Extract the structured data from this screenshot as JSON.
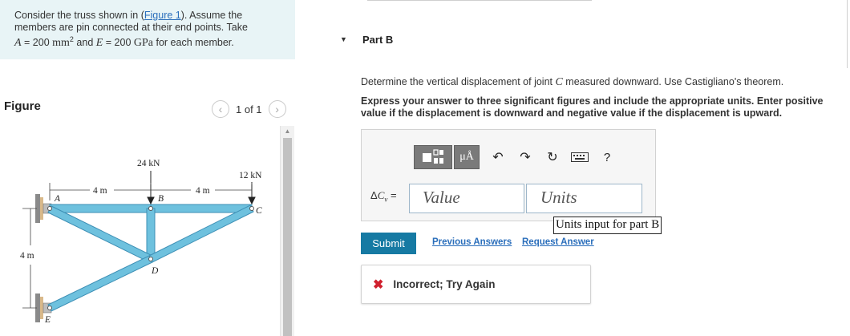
{
  "problem": {
    "text_1": "Consider the truss shown in (",
    "figure_link": "Figure 1",
    "text_2": "). Assume the",
    "text_3": "members are pin connected at their end points. Take",
    "var_A": "A",
    "eq_A": " = 200 ",
    "unit_mm": "mm",
    "sup_2": "2",
    "and": " and ",
    "var_E": "E",
    "eq_E": " = 200 ",
    "unit_gpa": "GPa",
    "text_4": " for each member."
  },
  "figure": {
    "heading": "Figure",
    "pager_text": "1 of 1",
    "prev_icon": "chevron-left-icon",
    "next_icon": "chevron-right-icon",
    "labels": {
      "load_b": "24 kN",
      "load_c": "12 kN",
      "span_1": "4 m",
      "span_2": "4 m",
      "height": "4 m",
      "node_a": "A",
      "node_b": "B",
      "node_c": "C",
      "node_d": "D",
      "node_e": "E"
    },
    "member_color": "#6ec1de"
  },
  "part": {
    "toggle_icon": "caret-down-icon",
    "title": "Part B",
    "question_1": "Determine the vertical displacement of joint ",
    "question_var": "C",
    "question_2": " measured downward. Use Castigliano's theorem.",
    "instructions": "Express your answer to three significant figures and include the appropriate units. Enter positive value if the displacement is downward and negative value if the displacement is upward."
  },
  "toolbar": {
    "templates_icon": "fraction-template-icon",
    "units_label": "μÅ",
    "undo_icon": "undo-icon",
    "redo_icon": "redo-icon",
    "reset_icon": "reset-icon",
    "keyboard_icon": "keyboard-icon",
    "help_label": "?"
  },
  "answer": {
    "label_delta": "Δ",
    "label_sub": "C",
    "label_subsub": "v",
    "label_eq": " =",
    "value_placeholder": "Value",
    "units_placeholder": "Units",
    "tooltip": "Units input for part B"
  },
  "actions": {
    "submit": "Submit",
    "previous_answers": "Previous Answers",
    "request_answer": "Request Answer"
  },
  "feedback": {
    "icon": "x-icon",
    "text": "Incorrect; Try Again",
    "icon_color": "#d0202e"
  },
  "colors": {
    "accent": "#167aa3",
    "link": "#2a6ebb",
    "problem_bg": "#e8f4f6"
  }
}
